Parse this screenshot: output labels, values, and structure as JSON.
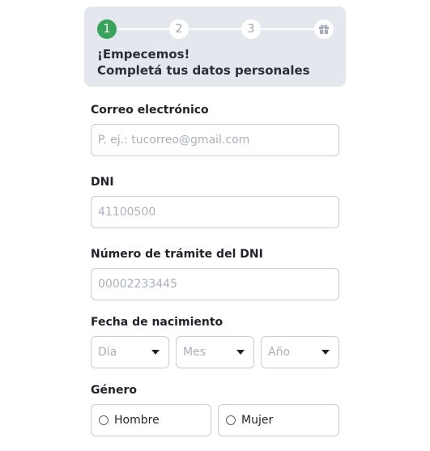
{
  "stepper": {
    "steps": [
      "1",
      "2",
      "3"
    ],
    "final_icon": "gift-icon",
    "active_step": 1,
    "colors": {
      "active": "#3aa35b",
      "inactive_text": "#9aa3ad"
    }
  },
  "header": {
    "title_line1": "¡Empecemos!",
    "title_line2": "Completá tus datos personales"
  },
  "form": {
    "email": {
      "label": "Correo electrónico",
      "placeholder": "P. ej.: tucorreo@gmail.com"
    },
    "dni": {
      "label": "DNI",
      "placeholder": "41100500"
    },
    "tramite": {
      "label": "Número de trámite del DNI",
      "placeholder": "00002233445"
    },
    "birth": {
      "label": "Fecha de nacimiento",
      "day": "Día",
      "month": "Mes",
      "year": "Año"
    },
    "gender": {
      "label": "Género",
      "options": [
        "Hombre",
        "Mujer"
      ]
    }
  }
}
